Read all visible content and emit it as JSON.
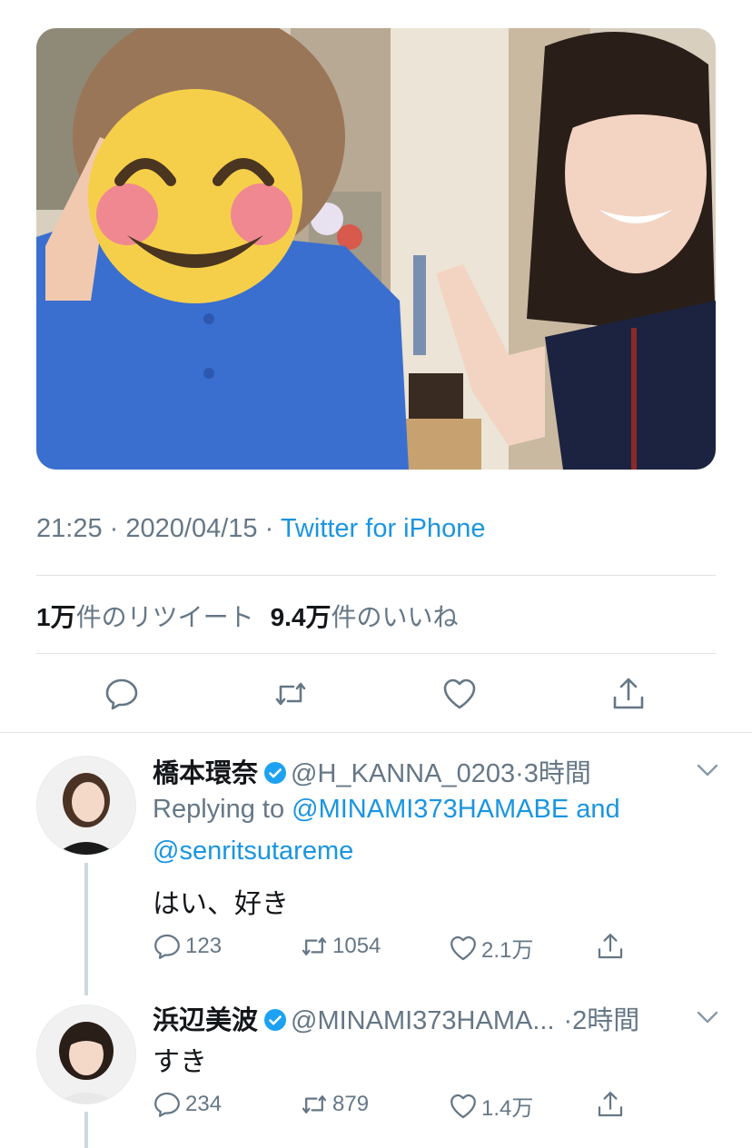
{
  "tweet": {
    "time": "21:25",
    "date": "2020/04/15",
    "separator": "·",
    "source": "Twitter for iPhone",
    "retweet_count": "1万",
    "retweet_label": "件のリツイート",
    "like_count": "9.4万",
    "like_label": "件のいいね"
  },
  "actions": [
    "reply-icon",
    "retweet-icon",
    "like-icon",
    "share-icon"
  ],
  "replies": [
    {
      "name": "橋本環奈",
      "handle": "@H_KANNA_0203",
      "time": "·3時間",
      "replying_prefix": "Replying to",
      "replying_to_1": "@MINAMI373HAMABE",
      "replying_and": "and",
      "replying_to_2": "@senritsutareme",
      "text": "はい、好き",
      "reply_count": "123",
      "retweet_count": "1054",
      "like_count": "2.1万"
    },
    {
      "name": "浜辺美波",
      "handle": "@MINAMI373HAMA...",
      "time": "·2時間",
      "text": "すき",
      "reply_count": "234",
      "retweet_count": "879",
      "like_count": "1.4万"
    }
  ],
  "colors": {
    "link_blue": "#1b95e0",
    "secondary_text": "#657786",
    "verified_blue": "#1da1f2",
    "emoji_yellow": "#f6cf4a",
    "shirt_blue": "#3a6fd0"
  }
}
